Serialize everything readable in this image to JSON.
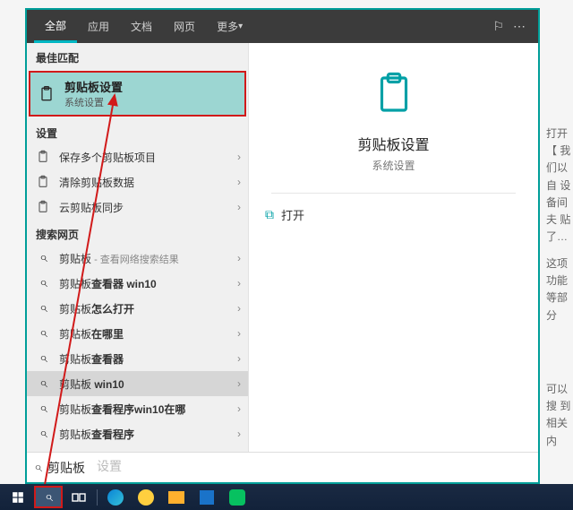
{
  "tabs": {
    "all": "全部",
    "apps": "应用",
    "docs": "文档",
    "web": "网页",
    "more": "更多"
  },
  "left": {
    "best_match_header": "最佳匹配",
    "best_match": {
      "title": "剪贴板设置",
      "sub": "系统设置"
    },
    "settings_header": "设置",
    "settings": [
      "保存多个剪贴板项目",
      "清除剪贴板数据",
      "云剪贴板同步"
    ],
    "web_header": "搜索网页",
    "web_items": [
      {
        "pre": "剪贴板",
        "bold": "",
        "post": "",
        "sub": " - 查看网络搜索结果"
      },
      {
        "pre": "剪贴板",
        "bold": "查看器 win10",
        "post": "",
        "sub": ""
      },
      {
        "pre": "剪贴板",
        "bold": "怎么打开",
        "post": "",
        "sub": ""
      },
      {
        "pre": "剪贴板",
        "bold": "在哪里",
        "post": "",
        "sub": ""
      },
      {
        "pre": "剪贴板",
        "bold": "查看器",
        "post": "",
        "sub": ""
      },
      {
        "pre": "剪贴板",
        "bold": " win10",
        "post": "",
        "sub": ""
      },
      {
        "pre": "剪贴板",
        "bold": "查看程序win10在哪",
        "post": "",
        "sub": ""
      },
      {
        "pre": "剪贴板",
        "bold": "查看程序",
        "post": "",
        "sub": ""
      }
    ],
    "highlight_index": 5
  },
  "preview": {
    "title": "剪贴板设置",
    "sub": "系统设置",
    "open": "打开"
  },
  "search": {
    "value": "剪贴板",
    "ghost": "设置"
  },
  "side_text": {
    "a": "打开【\n我们以自\n设备间夫\n贴了…",
    "b": "这项功能\n等部分",
    "c": "可以搜\n到相关内"
  }
}
